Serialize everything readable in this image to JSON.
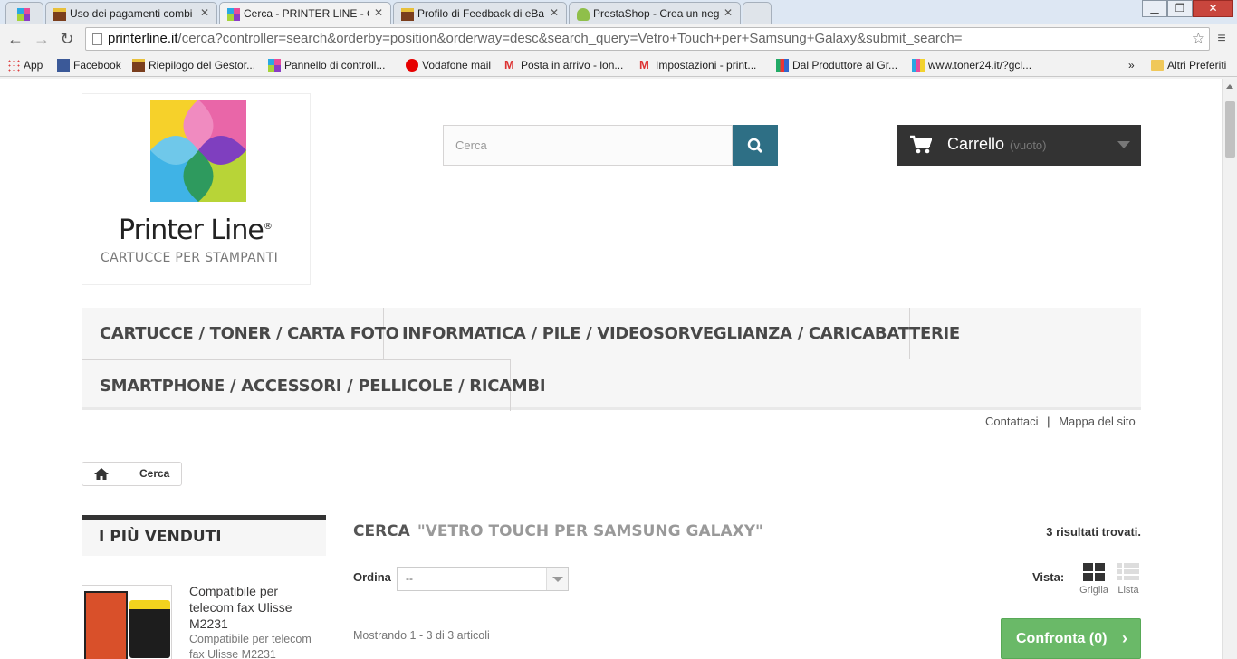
{
  "browser": {
    "tabs": [
      {
        "title": ""
      },
      {
        "title": "Uso dei pagamenti combi"
      },
      {
        "title": "Cerca - PRINTER LINE - Ca"
      },
      {
        "title": "Profilo di Feedback di eBa"
      },
      {
        "title": "PrestaShop - Crea un neg"
      }
    ],
    "url_host": "printerline.it",
    "url_path": "/cerca?controller=search&orderby=position&orderway=desc&search_query=Vetro+Touch+per+Samsung+Galaxy&submit_search=",
    "bookmarks": [
      {
        "label": "App"
      },
      {
        "label": "Facebook"
      },
      {
        "label": "Riepilogo del Gestor..."
      },
      {
        "label": "Pannello di controll..."
      },
      {
        "label": "Vodafone mail"
      },
      {
        "label": "Posta in arrivo - lon..."
      },
      {
        "label": "Impostazioni - print..."
      },
      {
        "label": "Dal Produttore al Gr..."
      },
      {
        "label": "www.toner24.it/?gcl..."
      }
    ],
    "bookmarks_overflow": "»",
    "other_bookmarks": "Altri Preferiti",
    "window_controls": {
      "minimize": "▁",
      "maximize": "❐",
      "close": "✕"
    }
  },
  "header": {
    "logo_title": "Printer Line",
    "logo_registered": "®",
    "logo_subtitle": "CARTUCCE PER STAMPANTI",
    "search_placeholder": "Cerca",
    "cart_label": "Carrello",
    "cart_status": "(vuoto)"
  },
  "menu": {
    "items": [
      {
        "label": "CARTUCCE / TONER / CARTA FOTO"
      },
      {
        "label": "INFORMATICA / PILE / VIDEOSORVEGLIANZA / CARICABATTERIE"
      },
      {
        "label": "SMARTPHONE / ACCESSORI / PELLICOLE / RICAMBI"
      }
    ]
  },
  "top_links": {
    "contact": "Contattaci",
    "separator": "|",
    "sitemap": "Mappa del sito"
  },
  "breadcrumb": {
    "current": "Cerca"
  },
  "sidebar": {
    "title": "I PIÙ VENDUTI",
    "product": {
      "name": "Compatibile per telecom fax Ulisse M2231",
      "description": "Compatibile per telecom fax  Ulisse M2231"
    }
  },
  "results": {
    "heading": "CERCA",
    "query": "\"VETRO TOUCH PER SAMSUNG GALAXY\"",
    "count": "3 risultati trovati.",
    "sort_label": "Ordina",
    "sort_value": "--",
    "view_label": "Vista:",
    "view_grid": "Griglia",
    "view_list": "Lista",
    "showing": "Mostrando 1 - 3 di 3 articoli",
    "compare_button": "Confronta (0)"
  },
  "colors": {
    "dark": "#333333",
    "green": "#6ab968",
    "search_button": "#2e6f85"
  }
}
